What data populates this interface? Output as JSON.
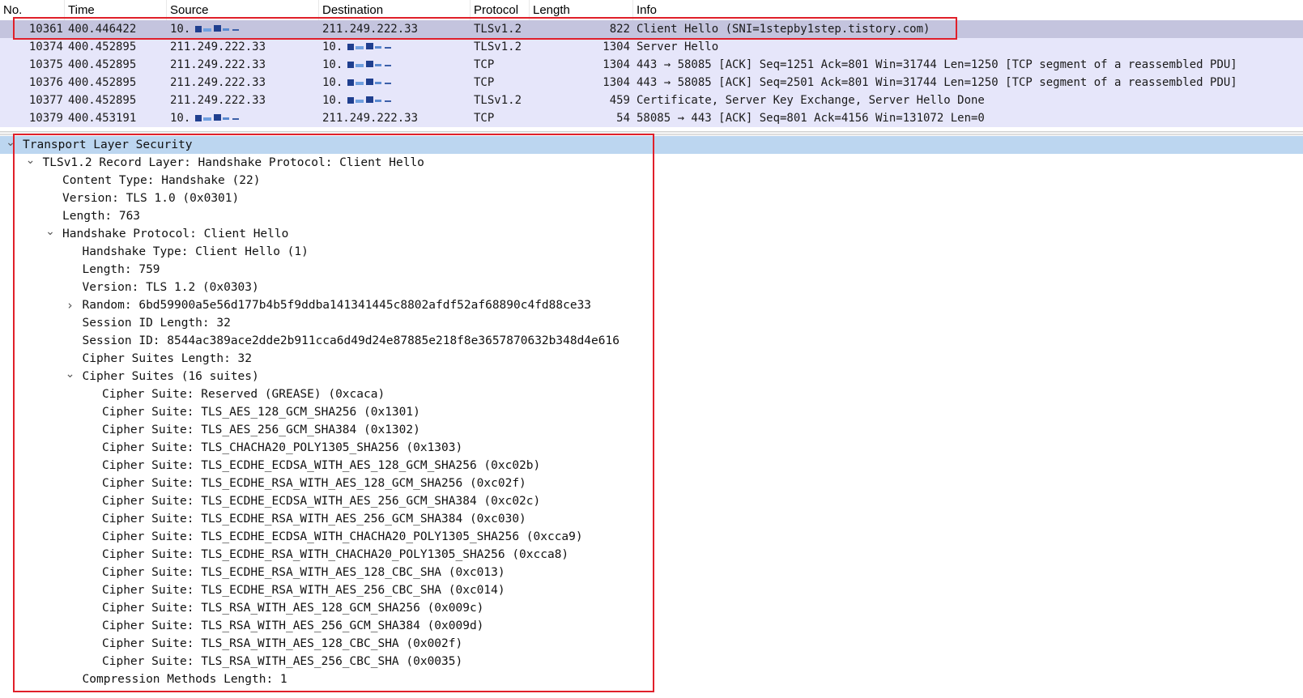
{
  "packet_list": {
    "columns": [
      "No.",
      "Time",
      "Source",
      "Destination",
      "Protocol",
      "Length",
      "Info"
    ],
    "rows": [
      {
        "no": "10361",
        "time": "400.446422",
        "source": "10.",
        "destination": "211.249.222.33",
        "protocol": "TLSv1.2",
        "length": "822",
        "info": "Client Hello (SNI=1stepby1step.tistory.com)",
        "selected": true,
        "src_redacted": true,
        "dst_redacted": false
      },
      {
        "no": "10374",
        "time": "400.452895",
        "source": "211.249.222.33",
        "destination": "10.",
        "protocol": "TLSv1.2",
        "length": "1304",
        "info": "Server Hello",
        "selected": false,
        "src_redacted": false,
        "dst_redacted": true
      },
      {
        "no": "10375",
        "time": "400.452895",
        "source": "211.249.222.33",
        "destination": "10.",
        "protocol": "TCP",
        "length": "1304",
        "info": "443 → 58085 [ACK] Seq=1251 Ack=801 Win=31744 Len=1250 [TCP segment of a reassembled PDU]",
        "selected": false,
        "src_redacted": false,
        "dst_redacted": true
      },
      {
        "no": "10376",
        "time": "400.452895",
        "source": "211.249.222.33",
        "destination": "10.",
        "protocol": "TCP",
        "length": "1304",
        "info": "443 → 58085 [ACK] Seq=2501 Ack=801 Win=31744 Len=1250 [TCP segment of a reassembled PDU]",
        "selected": false,
        "src_redacted": false,
        "dst_redacted": true
      },
      {
        "no": "10377",
        "time": "400.452895",
        "source": "211.249.222.33",
        "destination": "10.",
        "protocol": "TLSv1.2",
        "length": "459",
        "info": "Certificate, Server Key Exchange, Server Hello Done",
        "selected": false,
        "src_redacted": false,
        "dst_redacted": true
      },
      {
        "no": "10379",
        "time": "400.453191",
        "source": "10.",
        "destination": "211.249.222.33",
        "protocol": "TCP",
        "length": "54",
        "info": "58085 → 443 [ACK] Seq=801 Ack=4156 Win=131072 Len=0",
        "selected": false,
        "src_redacted": true,
        "dst_redacted": false
      }
    ]
  },
  "detail_tree": [
    {
      "text": "Transport Layer Security",
      "level": 0,
      "arrow": "expanded",
      "highlight": true
    },
    {
      "text": "TLSv1.2 Record Layer: Handshake Protocol: Client Hello",
      "level": 1,
      "arrow": "expanded"
    },
    {
      "text": "Content Type: Handshake (22)",
      "level": 2,
      "arrow": "none"
    },
    {
      "text": "Version: TLS 1.0 (0x0301)",
      "level": 2,
      "arrow": "none"
    },
    {
      "text": "Length: 763",
      "level": 2,
      "arrow": "none"
    },
    {
      "text": "Handshake Protocol: Client Hello",
      "level": 2,
      "arrow": "expanded"
    },
    {
      "text": "Handshake Type: Client Hello (1)",
      "level": 3,
      "arrow": "none"
    },
    {
      "text": "Length: 759",
      "level": 3,
      "arrow": "none"
    },
    {
      "text": "Version: TLS 1.2 (0x0303)",
      "level": 3,
      "arrow": "none"
    },
    {
      "text": "Random: 6bd59900a5e56d177b4b5f9ddba141341445c8802afdf52af68890c4fd88ce33",
      "level": 3,
      "arrow": "collapsed"
    },
    {
      "text": "Session ID Length: 32",
      "level": 3,
      "arrow": "none"
    },
    {
      "text": "Session ID: 8544ac389ace2dde2b911cca6d49d24e87885e218f8e3657870632b348d4e616",
      "level": 3,
      "arrow": "none"
    },
    {
      "text": "Cipher Suites Length: 32",
      "level": 3,
      "arrow": "none"
    },
    {
      "text": "Cipher Suites (16 suites)",
      "level": 3,
      "arrow": "expanded"
    },
    {
      "text": "Cipher Suite: Reserved (GREASE) (0xcaca)",
      "level": 4,
      "arrow": "none"
    },
    {
      "text": "Cipher Suite: TLS_AES_128_GCM_SHA256 (0x1301)",
      "level": 4,
      "arrow": "none"
    },
    {
      "text": "Cipher Suite: TLS_AES_256_GCM_SHA384 (0x1302)",
      "level": 4,
      "arrow": "none"
    },
    {
      "text": "Cipher Suite: TLS_CHACHA20_POLY1305_SHA256 (0x1303)",
      "level": 4,
      "arrow": "none"
    },
    {
      "text": "Cipher Suite: TLS_ECDHE_ECDSA_WITH_AES_128_GCM_SHA256 (0xc02b)",
      "level": 4,
      "arrow": "none"
    },
    {
      "text": "Cipher Suite: TLS_ECDHE_RSA_WITH_AES_128_GCM_SHA256 (0xc02f)",
      "level": 4,
      "arrow": "none"
    },
    {
      "text": "Cipher Suite: TLS_ECDHE_ECDSA_WITH_AES_256_GCM_SHA384 (0xc02c)",
      "level": 4,
      "arrow": "none"
    },
    {
      "text": "Cipher Suite: TLS_ECDHE_RSA_WITH_AES_256_GCM_SHA384 (0xc030)",
      "level": 4,
      "arrow": "none"
    },
    {
      "text": "Cipher Suite: TLS_ECDHE_ECDSA_WITH_CHACHA20_POLY1305_SHA256 (0xcca9)",
      "level": 4,
      "arrow": "none"
    },
    {
      "text": "Cipher Suite: TLS_ECDHE_RSA_WITH_CHACHA20_POLY1305_SHA256 (0xcca8)",
      "level": 4,
      "arrow": "none"
    },
    {
      "text": "Cipher Suite: TLS_ECDHE_RSA_WITH_AES_128_CBC_SHA (0xc013)",
      "level": 4,
      "arrow": "none"
    },
    {
      "text": "Cipher Suite: TLS_ECDHE_RSA_WITH_AES_256_CBC_SHA (0xc014)",
      "level": 4,
      "arrow": "none"
    },
    {
      "text": "Cipher Suite: TLS_RSA_WITH_AES_128_GCM_SHA256 (0x009c)",
      "level": 4,
      "arrow": "none"
    },
    {
      "text": "Cipher Suite: TLS_RSA_WITH_AES_256_GCM_SHA384 (0x009d)",
      "level": 4,
      "arrow": "none"
    },
    {
      "text": "Cipher Suite: TLS_RSA_WITH_AES_128_CBC_SHA (0x002f)",
      "level": 4,
      "arrow": "none"
    },
    {
      "text": "Cipher Suite: TLS_RSA_WITH_AES_256_CBC_SHA (0x0035)",
      "level": 4,
      "arrow": "none"
    },
    {
      "text": "Compression Methods Length: 1",
      "level": 3,
      "arrow": "none"
    }
  ],
  "icons": {
    "expanded": "chevron-down-icon",
    "collapsed": "chevron-right-icon"
  },
  "colors": {
    "row_bg": "#e6e6fa",
    "selected_row_bg": "#c4c4de",
    "tree_highlight": "#bcd6f0",
    "annotation_red": "#e0202a"
  }
}
